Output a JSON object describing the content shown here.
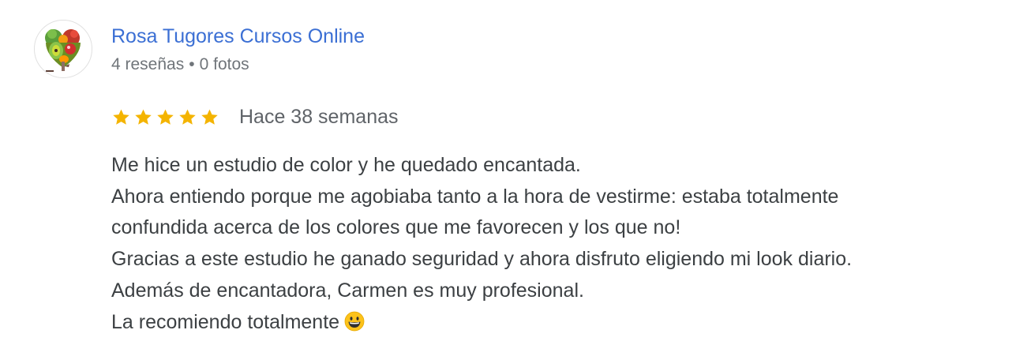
{
  "review": {
    "author": {
      "name": "Rosa Tugores Cursos Online",
      "reviews_count": "4 reseñas",
      "separator": "•",
      "photos_count": "0 fotos",
      "avatar_icon": "fruit-vegetable-heart-logo-icon"
    },
    "rating": {
      "stars": 5,
      "max_stars": 5,
      "star_color": "#f4b400",
      "date": "Hace 38 semanas"
    },
    "text_lines": [
      "Me hice un estudio de color y he quedado encantada.",
      "Ahora entiendo porque me agobiaba tanto a la hora de vestirme: estaba totalmente",
      "confundida acerca de los colores que me favorecen y los que no!",
      "Gracias a este estudio he ganado seguridad y ahora disfruto eligiendo mi look diario.",
      "Además de encantadora, Carmen es muy profesional.",
      "La recomiendo totalmente"
    ],
    "end_emoji_icon": "grinning-face-icon"
  },
  "colors": {
    "author_link": "#3b6fd4",
    "meta_text": "#70757a",
    "body_text": "#3c4043"
  }
}
